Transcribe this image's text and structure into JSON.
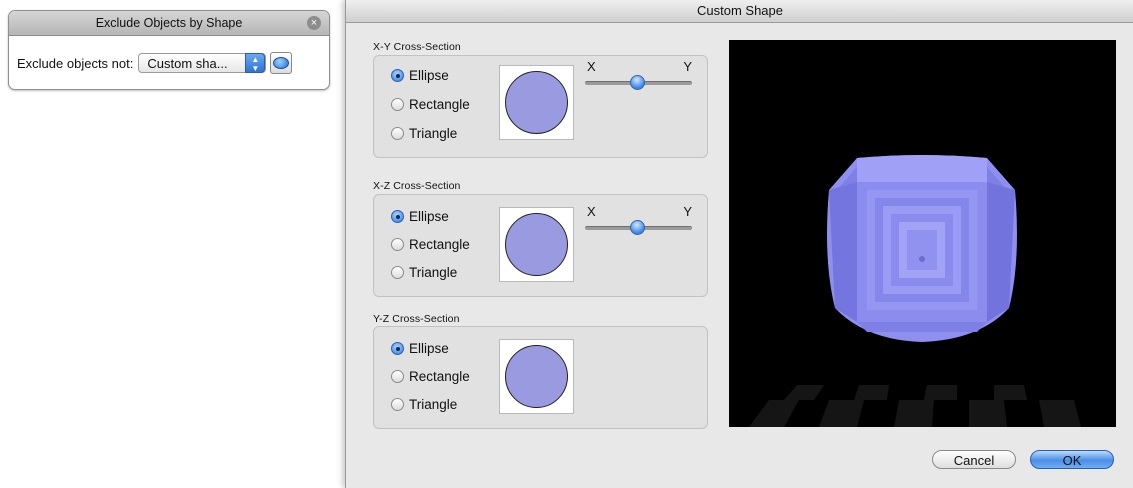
{
  "hud": {
    "title": "Exclude Objects by Shape",
    "label": "Exclude objects not:",
    "popup_value": "Custom sha...",
    "close_icon": "×"
  },
  "window": {
    "title": "Custom Shape",
    "sections": [
      {
        "label": "X-Y Cross-Section",
        "options": [
          "Ellipse",
          "Rectangle",
          "Triangle"
        ],
        "selected": "Ellipse",
        "slider": {
          "left_label": "X",
          "right_label": "Y",
          "value": 0.5
        }
      },
      {
        "label": "X-Z Cross-Section",
        "options": [
          "Ellipse",
          "Rectangle",
          "Triangle"
        ],
        "selected": "Ellipse",
        "slider": {
          "left_label": "X",
          "right_label": "Y",
          "value": 0.5
        }
      },
      {
        "label": "Y-Z Cross-Section",
        "options": [
          "Ellipse",
          "Rectangle",
          "Triangle"
        ],
        "selected": "Ellipse"
      }
    ],
    "buttons": {
      "cancel": "Cancel",
      "ok": "OK"
    }
  },
  "colors": {
    "shape_fill": "#9a9ae0",
    "accent": "#3b84e6",
    "preview_fill": "#8f8ff0"
  }
}
